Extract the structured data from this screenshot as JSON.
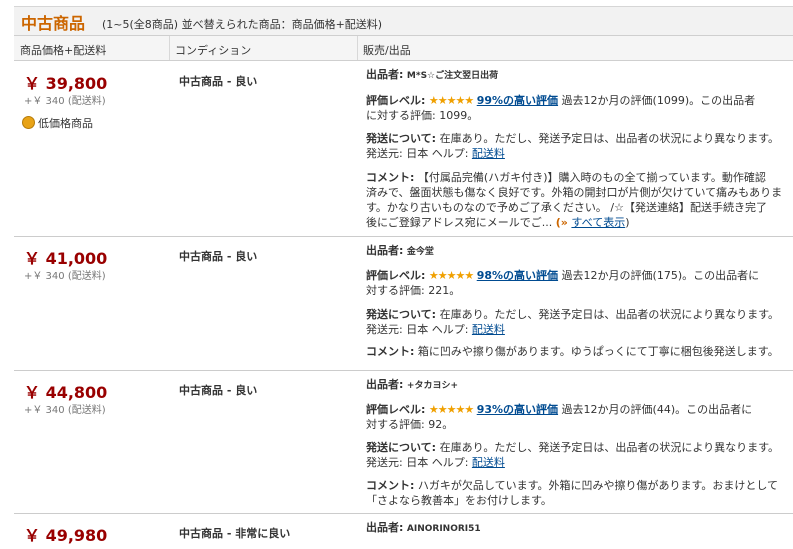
{
  "header": {
    "title": "中古商品",
    "range": "(1~5(全8商品) 並べ替えられた商品：商品価格+配送料)"
  },
  "columns": [
    "商品価格+配送料",
    "コンディション",
    "販売/出品"
  ],
  "labels": {
    "seller": "出品者:",
    "rating": "評価レベル:",
    "shipping": "発送について:",
    "comment": "コメント:",
    "stars": "★★★★★"
  },
  "offers": [
    {
      "price": "￥ 39,800",
      "shipping_fee": "+￥ 340 (配送料)",
      "badge": "低価格商品",
      "condition": "中古商品 - 良い",
      "seller": "M*S☆ご注文翌日出荷",
      "rating_pct": "99%の高い評価",
      "rating_l1": " 過去12か月の評価(1099)。この出品者",
      "rating_l2": "に対する評価: 1099。",
      "ship_l1": " 在庫あり。ただし、発送予定日は、出品者の状況により異なります。",
      "ship_l2": "発送元: 日本 ヘルプ: ",
      "ship_link": "配送料",
      "comment_l1": " 【付属品完備(ハガキ付き)】購入時のもの全て揃っています。動作確認",
      "comment_l2": "済みで、盤面状態も傷なく良好です。外箱の開封口が片側が欠けていて痛みもありま",
      "comment_l3": "す。かなり古いものなので予めご了承ください。 /☆【発送連絡】配送手続き完了",
      "comment_l4": "後にご登録アドレス宛にメールでご...",
      "more_arrow": "(»",
      "more_link": "すべて表示",
      "more_close": ")"
    },
    {
      "price": "￥ 41,000",
      "shipping_fee": "+￥ 340 (配送料)",
      "condition": "中古商品 - 良い",
      "seller": "金今堂",
      "rating_pct": "98%の高い評価",
      "rating_l1": " 過去12か月の評価(175)。この出品者に",
      "rating_l2": "対する評価: 221。",
      "ship_l1": " 在庫あり。ただし、発送予定日は、出品者の状況により異なります。",
      "ship_l2": "発送元: 日本 ヘルプ: ",
      "ship_link": "配送料",
      "comment_l1": " 箱に凹みや擦り傷があります。ゆうぱっくにて丁寧に梱包後発送します。"
    },
    {
      "price": "￥ 44,800",
      "shipping_fee": "+￥ 340 (配送料)",
      "condition": "中古商品 - 良い",
      "seller": "+タカヨシ+",
      "rating_pct": "93%の高い評価",
      "rating_l1": " 過去12か月の評価(44)。この出品者に",
      "rating_l2": "対する評価: 92。",
      "ship_l1": " 在庫あり。ただし、発送予定日は、出品者の状況により異なります。",
      "ship_l2": "発送元: 日本 ヘルプ: ",
      "ship_link": "配送料",
      "comment_l1": " ハガキが欠品しています。外箱に凹みや擦り傷があります。おまけとして",
      "comment_l2": "「さよなら教善本」をお付けします。"
    },
    {
      "price": "￥ 49,980",
      "condition": "中古商品 - 非常に良い",
      "seller": "AINORINORI51"
    }
  ]
}
